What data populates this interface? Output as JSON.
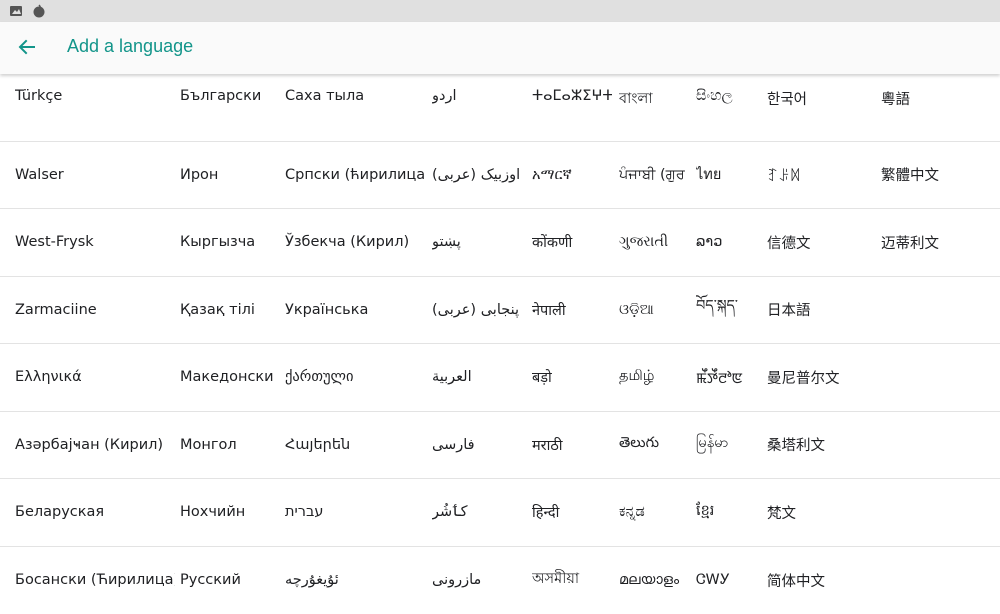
{
  "app_bar": {
    "title": "Add a language",
    "accent": "#13958a"
  },
  "status_bar": {
    "icons": [
      "image-icon",
      "notification-dot-icon"
    ]
  },
  "languages": [
    [
      "Türkçe",
      "Български",
      "Саха тыла",
      "اردو",
      "ⵜⴰⵎⴰⵣⵉⵖⵜ",
      "বাংলা",
      "සිංහල",
      "한국어",
      "粵語"
    ],
    [
      "Walser",
      "Ирон",
      "Српски (ћирилица)",
      "اوزبیک (عربی)",
      "አማርኛ",
      "ਪੰਜਾਬੀ (ਗੁਰ",
      "ไทย",
      "ꆈꌠꉙ",
      "繁體中文"
    ],
    [
      "West-Frysk",
      "Кыргызча",
      "Ўзбекча (Кирил)",
      "پښتو",
      "कोंकणी",
      "ગુજરાતી",
      "ລາວ",
      "信德文",
      "迈蒂利文"
    ],
    [
      "Zarmaciine",
      "Қазақ тілі",
      "Українська",
      "پنجابی (عربی)",
      "नेपाली",
      "ଓଡ଼ିଆ",
      "བོད་སྐད་",
      "日本語",
      ""
    ],
    [
      "Ελληνικά",
      "Македонски",
      "ქართული",
      "العربية",
      "बड़ो",
      "தமிழ்",
      "ꯃꯩꯇꯩꯂꯣꯟ",
      "曼尼普尔文",
      ""
    ],
    [
      "Азәрбајҹан (Кирил)",
      "Монгол",
      "Հայերեն",
      "فارسی",
      "मराठी",
      "తెలుగు",
      "မြန်မာ",
      "桑塔利文",
      ""
    ],
    [
      "Беларуская",
      "Нохчийн",
      "עברית",
      "كٲشُر",
      "हिन्दी",
      "ಕನ್ನಡ",
      "ខ្មែរ",
      "梵文",
      ""
    ],
    [
      "Босански (Ћирилица)",
      "Русский",
      "ئۇيغۇرچە",
      "مازرونی",
      "অসমীয়া",
      "മലയാളം",
      "ᏣᎳᎩ",
      "简体中文",
      ""
    ]
  ]
}
